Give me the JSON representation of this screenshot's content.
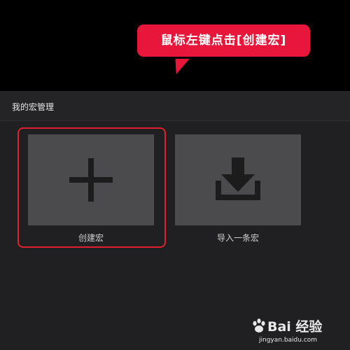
{
  "callout": {
    "text": "鼠标左键点击[创建宏]",
    "color": "#e8163a"
  },
  "panel": {
    "title": "我的宏管理"
  },
  "tiles": [
    {
      "label": "创建宏",
      "icon": "plus-icon",
      "highlighted": true
    },
    {
      "label": "导入一条宏",
      "icon": "download-icon",
      "highlighted": false
    }
  ],
  "colors": {
    "highlight_border": "#e0202e",
    "tile_background": "#4b4a4c",
    "icon_color": "#1c1c1c"
  },
  "watermark": {
    "logo_text": "Bai 经验",
    "url_text": "jingyan.baidu.com"
  }
}
